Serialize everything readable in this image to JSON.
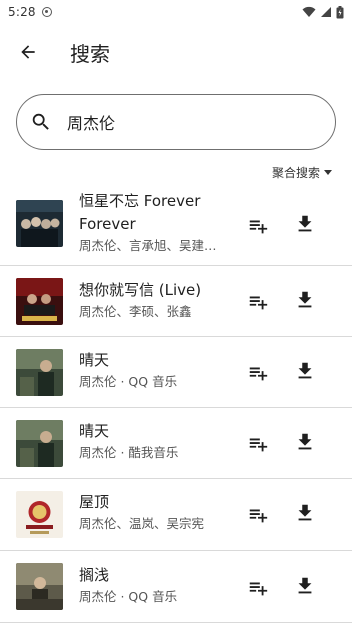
{
  "status": {
    "time": "5:28"
  },
  "app_bar": {
    "title": "搜索"
  },
  "search": {
    "value": "周杰伦",
    "placeholder": ""
  },
  "source": {
    "selected": "聚合搜索"
  },
  "songs": [
    {
      "title": "恒星不忘 Forever Forever",
      "subtitle": "周杰伦、言承旭、吴建豪、朱孝天"
    },
    {
      "title": "想你就写信 (Live)",
      "subtitle": "周杰伦、李硕、张鑫"
    },
    {
      "title": "晴天",
      "subtitle": "周杰伦 · QQ 音乐"
    },
    {
      "title": "晴天",
      "subtitle": "周杰伦 · 酷我音乐"
    },
    {
      "title": "屋顶",
      "subtitle": "周杰伦、温岚、吴宗宪"
    },
    {
      "title": "搁浅",
      "subtitle": "周杰伦 · QQ 音乐"
    }
  ]
}
